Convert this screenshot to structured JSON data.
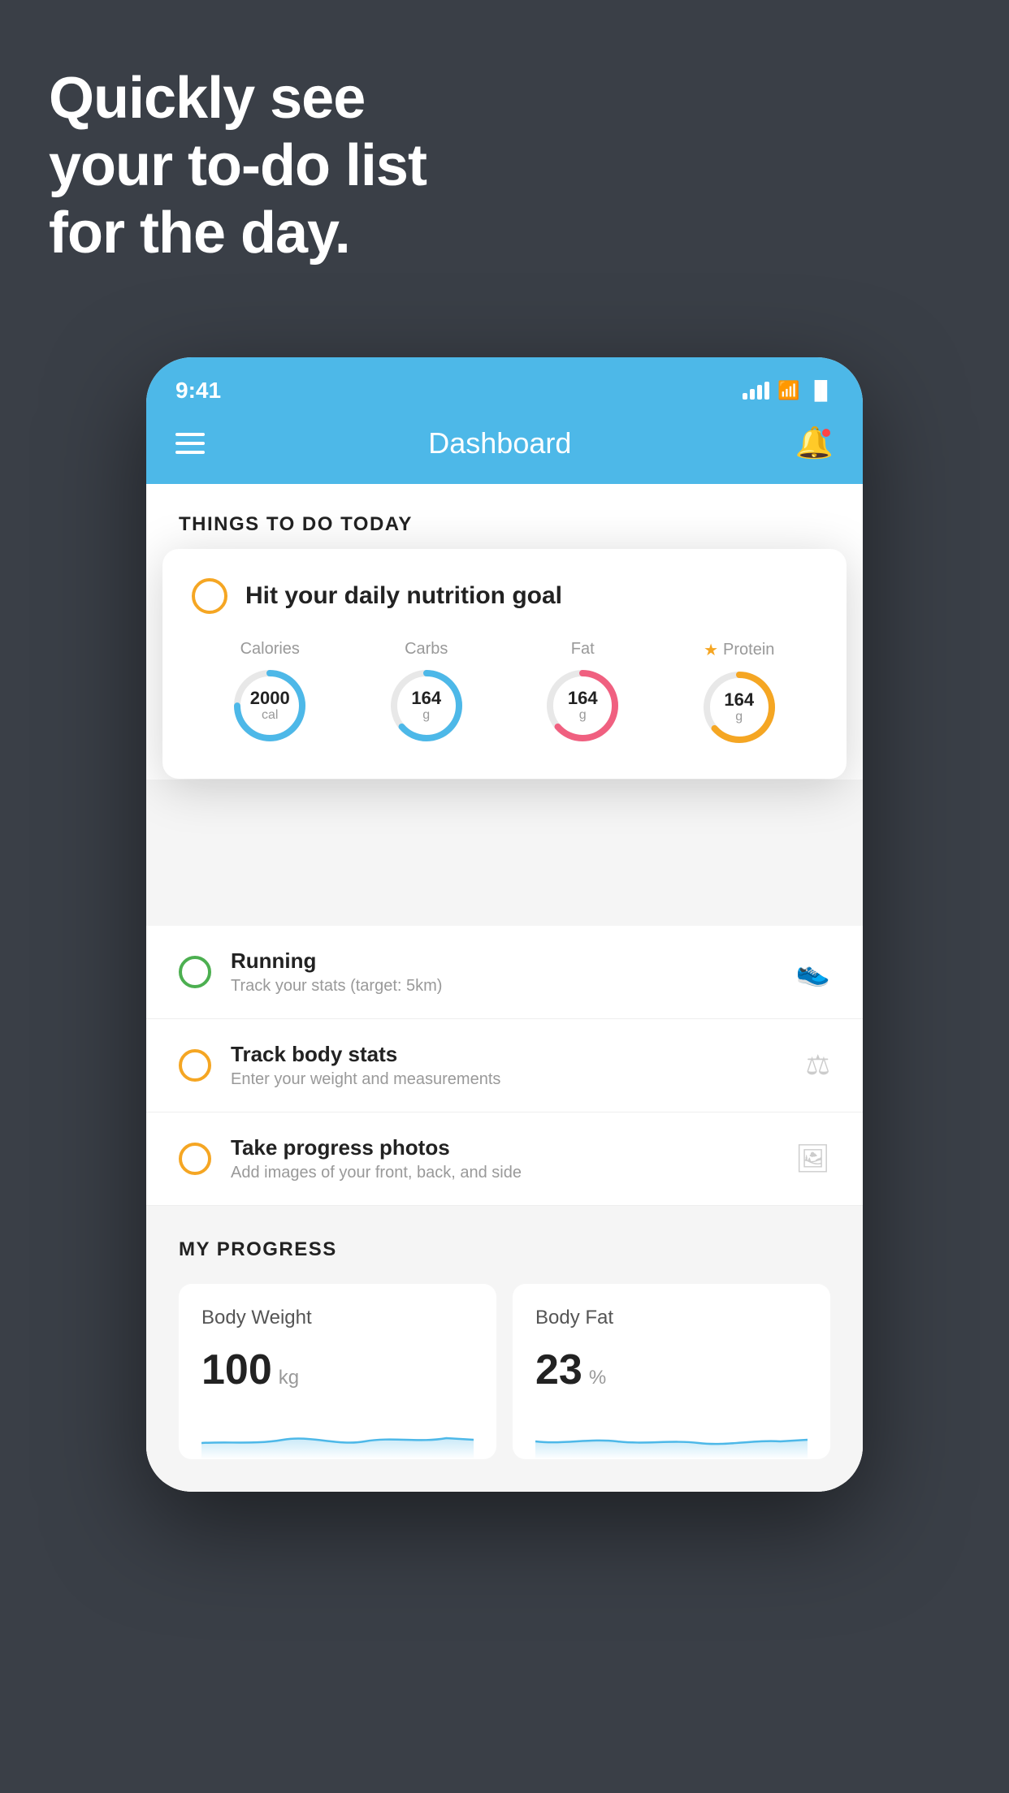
{
  "hero": {
    "line1": "Quickly see",
    "line2": "your to-do list",
    "line3": "for the day."
  },
  "status_bar": {
    "time": "9:41"
  },
  "header": {
    "title": "Dashboard"
  },
  "floating_card": {
    "title": "Hit your daily nutrition goal",
    "nutrition": [
      {
        "label": "Calories",
        "value": "2000",
        "unit": "cal",
        "color": "blue",
        "star": false
      },
      {
        "label": "Carbs",
        "value": "164",
        "unit": "g",
        "color": "blue",
        "star": false
      },
      {
        "label": "Fat",
        "value": "164",
        "unit": "g",
        "color": "red",
        "star": false
      },
      {
        "label": "Protein",
        "value": "164",
        "unit": "g",
        "color": "yellow",
        "star": true
      }
    ]
  },
  "tasks": [
    {
      "name": "Running",
      "desc": "Track your stats (target: 5km)",
      "circle_color": "green",
      "icon": "shoe"
    },
    {
      "name": "Track body stats",
      "desc": "Enter your weight and measurements",
      "circle_color": "yellow",
      "icon": "scale"
    },
    {
      "name": "Take progress photos",
      "desc": "Add images of your front, back, and side",
      "circle_color": "yellow",
      "icon": "person"
    }
  ],
  "progress": {
    "section_title": "MY PROGRESS",
    "cards": [
      {
        "title": "Body Weight",
        "value": "100",
        "unit": "kg"
      },
      {
        "title": "Body Fat",
        "value": "23",
        "unit": "%"
      }
    ]
  },
  "things_title": "THINGS TO DO TODAY"
}
